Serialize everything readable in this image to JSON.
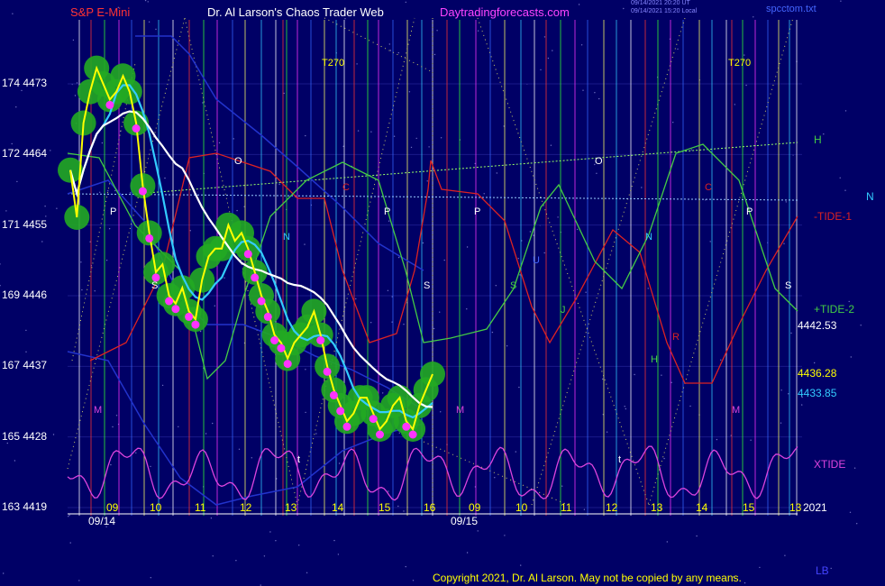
{
  "header": {
    "symbol": "S&P E-Mini",
    "title": "Dr. Al Larson's Chaos Trader Web",
    "site": "Daytradingforecasts.com",
    "timestamp_ut": "09/14/2021 20:20 UT",
    "timestamp_local": "09/14/2021 15:20 Local",
    "file": "spcctom.txt"
  },
  "footer": {
    "copyright": "Copyright 2021, Dr. Al Larson. May not be copied by any means.",
    "lb_label": "LB"
  },
  "colors": {
    "background": "#000066",
    "price": "#ffff00",
    "band": "#22aa22",
    "flux_dots": "#ff33ff",
    "ma_fast": "#33ccff",
    "ma_slow": "#ffffff",
    "tide1": "#dd2222",
    "tide2": "#44cc44",
    "xtide": "#dd44dd",
    "envelope": "#2233cc"
  },
  "chart_data": {
    "type": "line",
    "y_axis_left": [
      {
        "deg": "174",
        "price": "4473"
      },
      {
        "deg": "172",
        "price": "4464"
      },
      {
        "deg": "171",
        "price": "4455"
      },
      {
        "deg": "169",
        "price": "4446"
      },
      {
        "deg": "167",
        "price": "4437"
      },
      {
        "deg": "165",
        "price": "4428"
      },
      {
        "deg": "163",
        "price": "4419"
      }
    ],
    "ylim": [
      4419,
      4473
    ],
    "hour_ticks": [
      {
        "label": "09",
        "day": 0
      },
      {
        "label": "10",
        "day": 0
      },
      {
        "label": "11",
        "day": 0
      },
      {
        "label": "12",
        "day": 0
      },
      {
        "label": "13",
        "day": 0
      },
      {
        "label": "14",
        "day": 0
      },
      {
        "label": "15",
        "day": 0
      },
      {
        "label": "16",
        "day": 0
      },
      {
        "label": "09",
        "day": 1
      },
      {
        "label": "10",
        "day": 1
      },
      {
        "label": "11",
        "day": 1
      },
      {
        "label": "12",
        "day": 1
      },
      {
        "label": "13",
        "day": 1
      },
      {
        "label": "14",
        "day": 1
      },
      {
        "label": "15",
        "day": 1
      },
      {
        "label": "13",
        "day": 1
      }
    ],
    "dates": [
      "09/14",
      "09/15"
    ],
    "year": "2021",
    "right_labels": [
      {
        "text": "H",
        "color": "#44cc44"
      },
      {
        "text": "N",
        "color": "#33ccff"
      },
      {
        "text": "-TIDE-1",
        "color": "#dd2222"
      },
      {
        "text": "+TIDE-2",
        "color": "#44cc44"
      },
      {
        "text": "4442.53",
        "color": "#ffffff"
      },
      {
        "text": "4436.28",
        "color": "#ffff00"
      },
      {
        "text": "4433.85",
        "color": "#33ccff"
      },
      {
        "text": "XTIDE",
        "color": "#dd44dd"
      }
    ],
    "annotations": [
      {
        "text": "T270",
        "color": "#ffff00"
      },
      {
        "text": "T270",
        "color": "#ffff00"
      },
      {
        "text": "O",
        "color": "#ffffff"
      },
      {
        "text": "O",
        "color": "#ffffff"
      },
      {
        "text": "P",
        "color": "#ffffff"
      },
      {
        "text": "P",
        "color": "#ffffff"
      },
      {
        "text": "P",
        "color": "#ffffff"
      },
      {
        "text": "P",
        "color": "#ffffff"
      },
      {
        "text": "C",
        "color": "#dd2222"
      },
      {
        "text": "C",
        "color": "#dd2222"
      },
      {
        "text": "N",
        "color": "#33ccff"
      },
      {
        "text": "N",
        "color": "#33ccff"
      },
      {
        "text": "S",
        "color": "#ffffff"
      },
      {
        "text": "S",
        "color": "#ffffff"
      },
      {
        "text": "S",
        "color": "#44cc44"
      },
      {
        "text": "S",
        "color": "#ffffff"
      },
      {
        "text": "M",
        "color": "#dd44dd"
      },
      {
        "text": "M",
        "color": "#dd44dd"
      },
      {
        "text": "M",
        "color": "#dd44dd"
      },
      {
        "text": "U",
        "color": "#4466ff"
      },
      {
        "text": "J",
        "color": "#44cc44"
      },
      {
        "text": "R",
        "color": "#dd2222"
      },
      {
        "text": "H",
        "color": "#44cc44"
      },
      {
        "text": "t",
        "color": "#ffffff"
      },
      {
        "text": "t",
        "color": "#ffffff"
      }
    ],
    "series": [
      {
        "name": "",
        "values": [
          4462,
          4456,
          4468,
          4472,
          4475,
          4473,
          4471,
          4472,
          4474,
          4472,
          4468,
          4460,
          4454,
          4449,
          4450,
          4446,
          4445,
          4447,
          4444,
          4443,
          4448,
          4451,
          4452,
          4452,
          4455,
          4453,
          4454,
          4452,
          4449,
          4446,
          4444,
          4441,
          4440,
          4438,
          4440,
          4441,
          4442,
          4444,
          4441,
          4437,
          4434,
          4432,
          4430,
          4431,
          4433,
          4433,
          4431,
          4429,
          4430,
          4432,
          4433,
          4430,
          4429,
          4432,
          4434,
          4436
        ]
      }
    ]
  }
}
